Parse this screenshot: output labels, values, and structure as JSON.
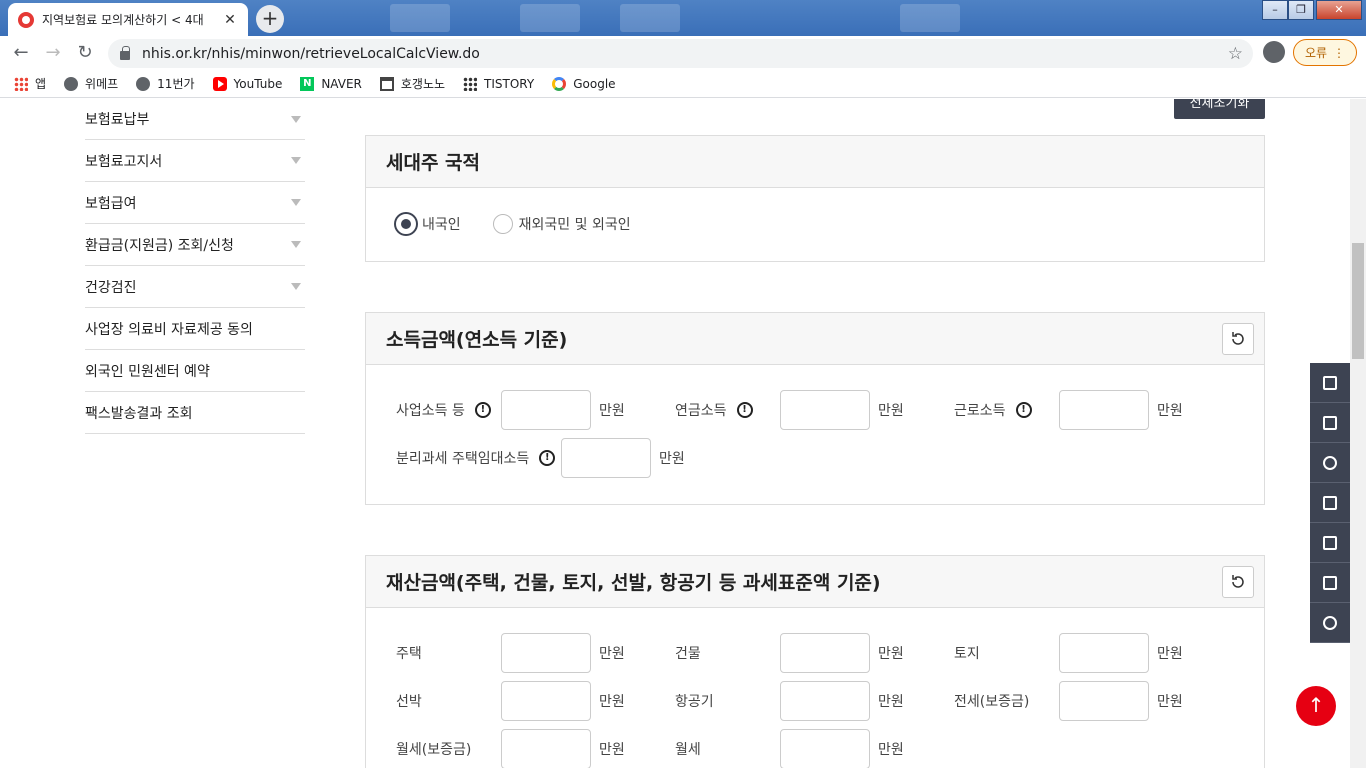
{
  "browser": {
    "tab_title": "지역보험료 모의계산하기 < 4대",
    "tab_close": "✕",
    "new_tab": "+",
    "url": "nhis.or.kr/nhis/minwon/retrieveLocalCalcView.do",
    "error_label": "오류",
    "bookmarks": [
      {
        "label": "앱",
        "icon": "apps-grid-icon"
      },
      {
        "label": "위메프",
        "icon": "globe-icon"
      },
      {
        "label": "11번가",
        "icon": "globe-icon"
      },
      {
        "label": "YouTube",
        "icon": "youtube-icon"
      },
      {
        "label": "NAVER",
        "icon": "naver-icon"
      },
      {
        "label": "호갱노노",
        "icon": "house-icon"
      },
      {
        "label": "TISTORY",
        "icon": "tistory-icon"
      },
      {
        "label": "Google",
        "icon": "google-icon"
      }
    ]
  },
  "sidebar": {
    "items": [
      {
        "label": "보험료납부",
        "has_submenu": true
      },
      {
        "label": "보험료고지서",
        "has_submenu": true
      },
      {
        "label": "보험급여",
        "has_submenu": true
      },
      {
        "label": "환급금(지원금) 조회/신청",
        "has_submenu": true
      },
      {
        "label": "건강검진",
        "has_submenu": true
      },
      {
        "label": "사업장 의료비 자료제공 동의",
        "has_submenu": false
      },
      {
        "label": "외국인 민원센터 예약",
        "has_submenu": false
      },
      {
        "label": "팩스발송결과 조회",
        "has_submenu": false
      }
    ]
  },
  "reset_all_label": "전체초기화",
  "nationality": {
    "title": "세대주 국적",
    "options": [
      {
        "label": "내국인",
        "selected": true
      },
      {
        "label": "재외국민 및 외국인",
        "selected": false
      }
    ]
  },
  "income": {
    "title": "소득금액(연소득 기준)",
    "unit": "만원",
    "fields": [
      {
        "label": "사업소득 등",
        "value": ""
      },
      {
        "label": "연금소득",
        "value": ""
      },
      {
        "label": "근로소득",
        "value": ""
      },
      {
        "label": "분리과세 주택임대소득",
        "value": ""
      }
    ]
  },
  "property": {
    "title": "재산금액(주택, 건물, 토지, 선발, 항공기 등 과세표준액 기준)",
    "unit": "만원",
    "fields": [
      {
        "label": "주택",
        "value": ""
      },
      {
        "label": "건물",
        "value": ""
      },
      {
        "label": "토지",
        "value": ""
      },
      {
        "label": "선박",
        "value": ""
      },
      {
        "label": "항공기",
        "value": ""
      },
      {
        "label": "전세(보증금)",
        "value": ""
      },
      {
        "label": "월세(보증금)",
        "value": ""
      },
      {
        "label": "월세",
        "value": ""
      }
    ]
  },
  "quick_menu": [
    "document-hand-icon",
    "monitor-icon",
    "headset-icon",
    "lock-icon",
    "list-icon",
    "copy-icon",
    "chat-icon"
  ],
  "to_top": "↑",
  "colors": {
    "accent_dark": "#3d4352",
    "top_button": "#e60012"
  }
}
